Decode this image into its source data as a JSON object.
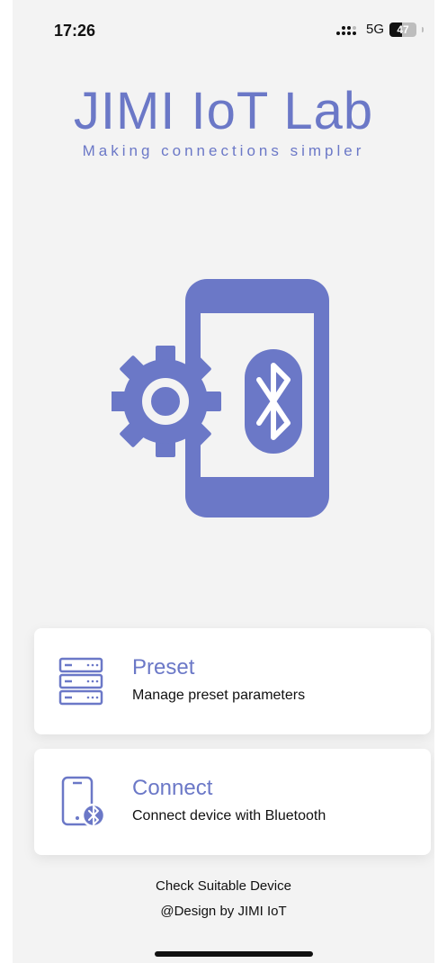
{
  "status_bar": {
    "time": "17:26",
    "network": "5G",
    "battery_percent": 47,
    "battery_label": "47"
  },
  "header": {
    "title": "JIMI IoT Lab",
    "tagline": "Making connections simpler"
  },
  "hero": {
    "icon": "phone-gear-bluetooth-icon"
  },
  "cards": {
    "preset": {
      "title": "Preset",
      "description": "Manage preset parameters",
      "icon": "server-stack-icon"
    },
    "connect": {
      "title": "Connect",
      "description": "Connect device with Bluetooth",
      "icon": "phone-bluetooth-icon"
    }
  },
  "footer": {
    "link": "Check Suitable Device",
    "credit": "@Design by JIMI IoT"
  },
  "colors": {
    "accent": "#6b78c7",
    "background": "#f3f3f3",
    "card": "#ffffff",
    "text": "#111111"
  }
}
